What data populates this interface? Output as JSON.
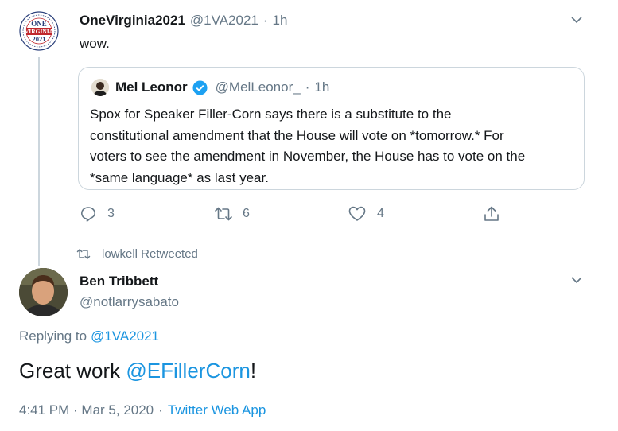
{
  "tweet1": {
    "display_name": "OneVirginia2021",
    "handle": "@1VA2021",
    "sep": "·",
    "time": "1h",
    "text": "wow.",
    "avatar": {
      "line1": "ONE",
      "line2": "VIRGINIA",
      "line3": "2021"
    },
    "quoted": {
      "display_name": "Mel Leonor",
      "handle": "@MelLeonor_",
      "sep": "·",
      "time": "1h",
      "lines": [
        "Spox for Speaker Filler-Corn says there is a substitute to the",
        "constitutional amendment that the House will vote on *tomorrow.* For",
        "voters to see the amendment in November, the House has to vote on the",
        "*same language* as last year."
      ]
    },
    "actions": {
      "replies": "3",
      "retweets": "6",
      "likes": "4"
    }
  },
  "retweet_context": "lowkell Retweeted",
  "tweet2": {
    "display_name": "Ben Tribbett",
    "handle": "@notlarrysabato",
    "replying_prefix": "Replying to",
    "replying_to": "@1VA2021",
    "text_before": "Great work",
    "mention": "@EFillerCorn",
    "text_after": "!",
    "timestamp": "4:41 PM · Mar 5, 2020",
    "sep": "·",
    "source": "Twitter Web App"
  },
  "colors": {
    "link": "#1b95e0",
    "muted": "#657786",
    "verified": "#1da1f2",
    "border": "#ccd6dd",
    "seal_red": "#c0272d",
    "seal_blue": "#2a3f7a"
  }
}
